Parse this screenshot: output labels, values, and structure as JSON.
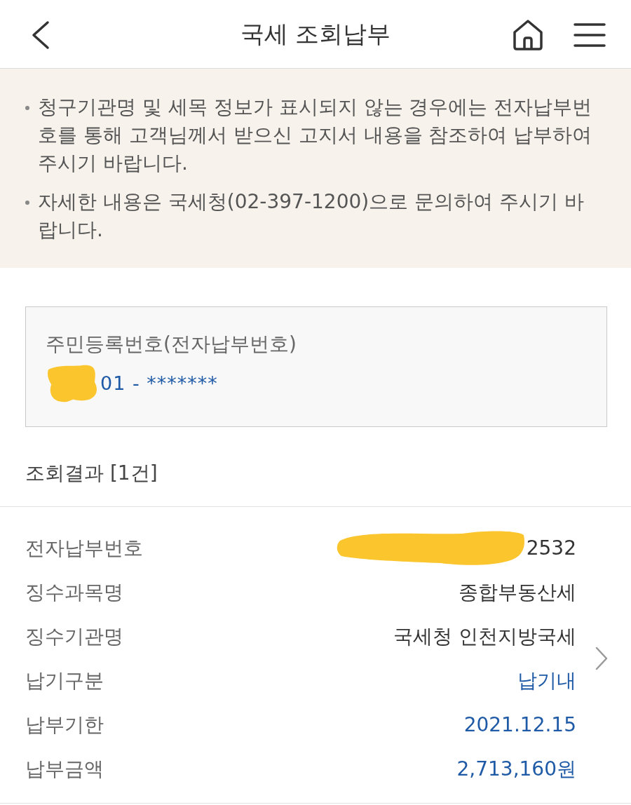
{
  "header": {
    "title": "국세 조회납부"
  },
  "notices": [
    "청구기관명 및 세목 정보가 표시되지 않는 경우에는 전자납부번호를 통해 고객님께서 받으신 고지서 내용을 참조하여 납부하여 주시기 바랍니다.",
    "자세한 내용은 국세청(02-397-1200)으로 문의하여 주시기 바랍니다."
  ],
  "id_box": {
    "label": "주민등록번호(전자납부번호)",
    "value": "01 - *******",
    "redacted": true
  },
  "results": {
    "title": "조회결과 [1건]",
    "rows": [
      {
        "label": "전자납부번호",
        "value": "2532",
        "redacted": true,
        "emphasis": false
      },
      {
        "label": "징수과목명",
        "value": "종합부동산세",
        "redacted": false,
        "emphasis": false
      },
      {
        "label": "징수기관명",
        "value": "국세청 인천지방국세",
        "redacted": false,
        "emphasis": false
      },
      {
        "label": "납기구분",
        "value": "납기내",
        "redacted": false,
        "emphasis": true
      },
      {
        "label": "납부기한",
        "value": "2021.12.15",
        "redacted": false,
        "emphasis": true
      },
      {
        "label": "납부금액",
        "value": "2,713,160원",
        "redacted": false,
        "emphasis": true
      }
    ]
  }
}
